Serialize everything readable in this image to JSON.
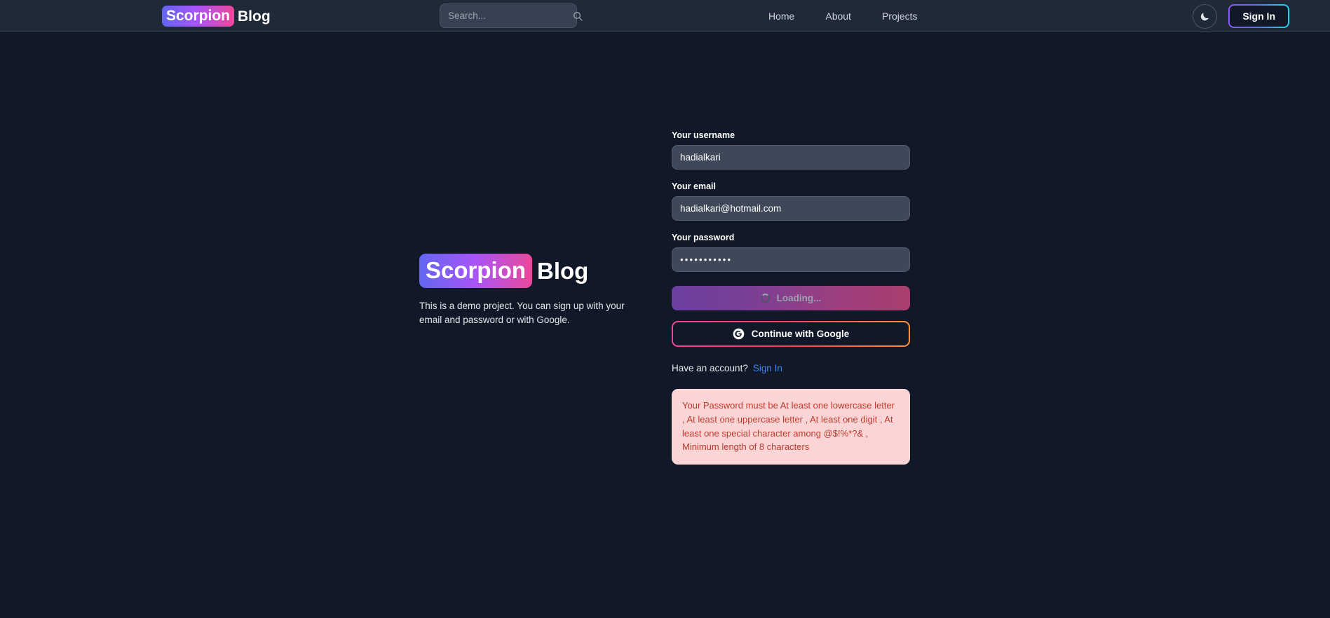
{
  "navbar": {
    "brand": {
      "highlight": "Scorpion",
      "rest": "Blog"
    },
    "search": {
      "placeholder": "Search...",
      "value": "",
      "icon": "search-icon"
    },
    "links": [
      {
        "label": "Home"
      },
      {
        "label": "About"
      },
      {
        "label": "Projects"
      }
    ],
    "theme_toggle": {
      "icon": "moon-icon",
      "mode": "dark"
    },
    "sign_in_label": "Sign In"
  },
  "hero": {
    "title_highlight": "Scorpion",
    "title_rest": "Blog",
    "description": "This is a demo project. You can sign up with your email and password or with Google."
  },
  "form": {
    "username": {
      "label": "Your username",
      "value": "hadialkari",
      "placeholder": ""
    },
    "email": {
      "label": "Your email",
      "value": "hadialkari@hotmail.com",
      "placeholder": ""
    },
    "password": {
      "label": "Your password",
      "value": "•••••••••••",
      "placeholder": ""
    },
    "submit_button": {
      "label": "Loading...",
      "state": "loading",
      "icon": "spinner-icon"
    },
    "google_button": {
      "label": "Continue with Google",
      "icon": "google-icon"
    },
    "have_account": {
      "text": "Have an account?",
      "link_label": "Sign In"
    },
    "alert": {
      "type": "error",
      "message": "Your Password must be At least one lowercase letter , At least one uppercase letter , At least one digit , At least one special character among @$!%*?& , Minimum length of 8 characters"
    }
  },
  "colors": {
    "page_bg": "#111827",
    "navbar_bg": "#1f2937",
    "input_bg": "#3f4859",
    "brand_gradient_start": "#6366f1",
    "brand_gradient_end": "#ec4899",
    "signin_gradient_start": "#8b5cf6",
    "signin_gradient_end": "#22d3ee",
    "google_gradient_start": "#ec4899",
    "google_gradient_end": "#fb923c",
    "link_blue": "#3b82f6",
    "alert_bg": "#fbd5d5",
    "alert_text": "#c0392b"
  }
}
